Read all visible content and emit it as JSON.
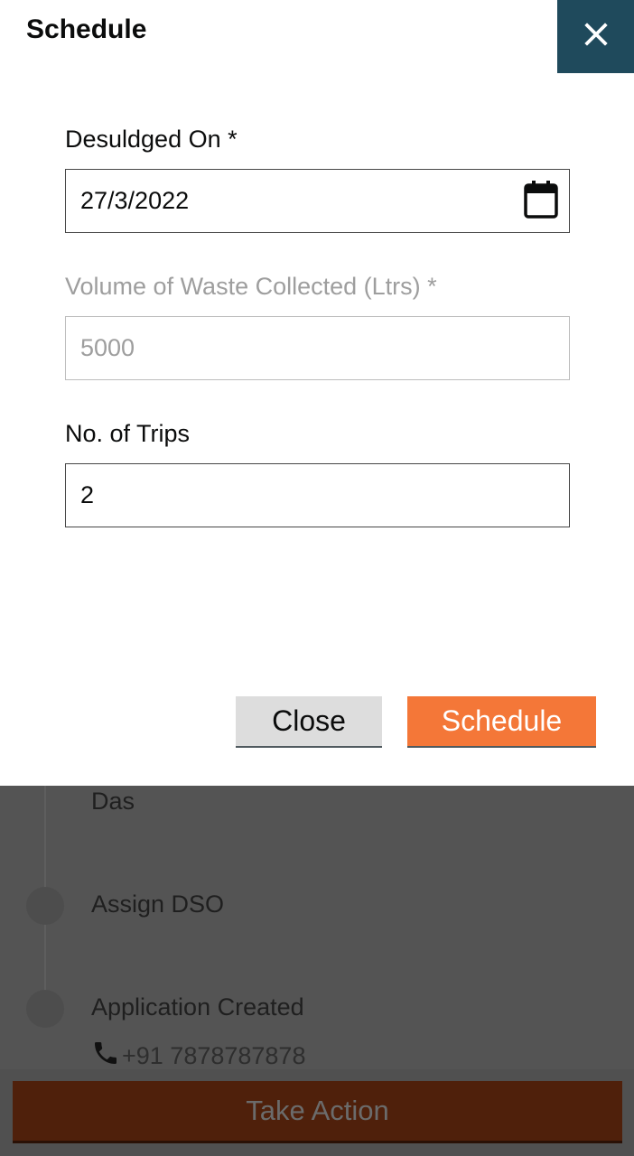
{
  "modal": {
    "title": "Schedule",
    "fields": [
      {
        "label": "Desuldged On *",
        "value": "27/3/2022"
      },
      {
        "label": "Volume of Waste Collected (Ltrs) *",
        "value": "5000"
      },
      {
        "label": "No. of Trips",
        "value": "2"
      }
    ],
    "close_label": "Close",
    "schedule_label": "Schedule"
  },
  "background": {
    "timeline": [
      {
        "text": "Das"
      },
      {
        "text": "Assign DSO"
      },
      {
        "text": "Application Created",
        "phone": "+91 7878787878"
      }
    ],
    "take_action_label": "Take Action"
  },
  "colors": {
    "header_close_bg": "#1f4a5c",
    "primary_button": "#f47738",
    "secondary_button": "#dddddd",
    "overlay": "#545454"
  },
  "icons": {
    "close": "close-icon",
    "calendar": "calendar-icon",
    "phone": "phone-icon"
  }
}
